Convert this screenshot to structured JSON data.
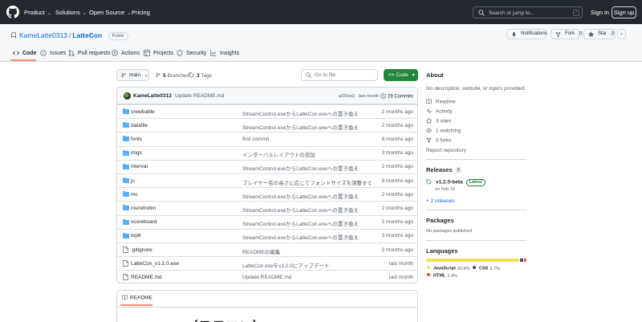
{
  "header": {
    "nav": [
      "Product",
      "Solutions",
      "Open Source",
      "Pricing"
    ],
    "search_placeholder": "Search or jump to...",
    "search_shortcut": "/",
    "signin": "Sign in",
    "signup": "Sign up"
  },
  "repo": {
    "owner": "KameLatte0313",
    "separator": "/",
    "name": "LatteCon",
    "visibility": "Public",
    "notifications_label": "Notifications",
    "fork_label": "Fork",
    "fork_count": "0",
    "star_label": "Star",
    "star_count": "3"
  },
  "tabs": [
    {
      "label": "Code",
      "icon": "code-icon"
    },
    {
      "label": "Issues",
      "icon": "issue-icon"
    },
    {
      "label": "Pull requests",
      "icon": "pull-request-icon"
    },
    {
      "label": "Actions",
      "icon": "play-icon"
    },
    {
      "label": "Projects",
      "icon": "table-icon"
    },
    {
      "label": "Security",
      "icon": "shield-icon"
    },
    {
      "label": "Insights",
      "icon": "graph-icon"
    }
  ],
  "toolbar": {
    "branch": "main",
    "branches_count": "5",
    "branches_label": "Branches",
    "tags_count": "3",
    "tags_label": "Tags",
    "goto_file_placeholder": "Go to file",
    "code_button": "Code"
  },
  "latest_commit": {
    "author": "KameLatte0313",
    "message": "Update README.md",
    "meta": "af35ea3 · last month",
    "commits_count": "29 Commits"
  },
  "files": [
    {
      "type": "dir",
      "name": "crewbattle",
      "message": "StreamControl.exeからLatteCon.exeへの置き換え",
      "date": "2 months ago"
    },
    {
      "type": "dir",
      "name": "datafile",
      "message": "StreamControl.exeからLatteCon.exeへの置き換え",
      "date": "2 months ago"
    },
    {
      "type": "dir",
      "name": "fonts",
      "message": "first commit",
      "date": "8 months ago"
    },
    {
      "type": "dir",
      "name": "imgs",
      "message": "インターバルレイアウトの追加",
      "date": "3 months ago"
    },
    {
      "type": "dir",
      "name": "interval",
      "message": "StreamControl.exeからLatteCon.exeへの置き換え",
      "date": "2 months ago"
    },
    {
      "type": "dir",
      "name": "js",
      "message": "プレイヤー名の長さに応じてフォントサイズを調整する機...",
      "date": "8 months ago"
    },
    {
      "type": "dir",
      "name": "mc",
      "message": "StreamControl.exeからLatteCon.exeへの置き換え",
      "date": "2 months ago"
    },
    {
      "type": "dir",
      "name": "roundrobin",
      "message": "StreamControl.exeからLatteCon.exeへの置き換え",
      "date": "2 months ago"
    },
    {
      "type": "dir",
      "name": "scoreboard",
      "message": "StreamControl.exeからLatteCon.exeへの置き換え",
      "date": "2 months ago"
    },
    {
      "type": "dir",
      "name": "top8",
      "message": "StreamControl.exeからLatteCon.exeへの置き換え",
      "date": "3 months ago"
    },
    {
      "type": "file",
      "name": ".gitignore",
      "message": "READMEの編集",
      "date": "3 months ago"
    },
    {
      "type": "file",
      "name": "LatteCon_v1.2.0.exe",
      "message": "LatteCon.exeをv1.2.0にアップデート",
      "date": "last month"
    },
    {
      "type": "file",
      "name": "README.md",
      "message": "Update README.md",
      "date": "last month"
    }
  ],
  "readme": {
    "tab_label": "README",
    "heading": "LatteCon（ラテコン）"
  },
  "sidebar": {
    "about_title": "About",
    "description": "No description, website, or topics provided.",
    "items": [
      {
        "icon": "book-icon",
        "label": "Readme"
      },
      {
        "icon": "pulse-icon",
        "label": "Activity"
      },
      {
        "icon": "star-icon",
        "label": "3 stars"
      },
      {
        "icon": "eye-icon",
        "label": "1 watching"
      },
      {
        "icon": "fork-icon",
        "label": "0 forks"
      }
    ],
    "report": "Report repository",
    "releases_title": "Releases",
    "releases_count": "3",
    "release_name": "v1.2.0-beta",
    "release_badge": "Latest",
    "release_date": "on Feb 10",
    "more_releases": "+ 2 releases",
    "packages_title": "Packages",
    "packages_text": "No packages published",
    "languages_title": "Languages",
    "languages": [
      {
        "name": "JavaScript",
        "percent": "93.9%",
        "value": 93.9,
        "color": "#f1e05a"
      },
      {
        "name": "CSS",
        "percent": "3.7%",
        "value": 3.7,
        "color": "#563d7c"
      },
      {
        "name": "HTML",
        "percent": "2.4%",
        "value": 2.4,
        "color": "#e34c26"
      }
    ]
  }
}
